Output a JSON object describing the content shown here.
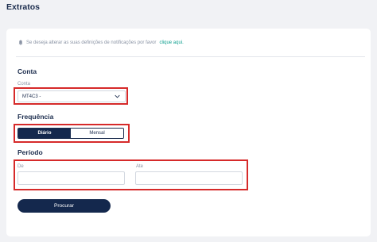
{
  "page": {
    "title": "Extratos"
  },
  "notice": {
    "text": "Se deseja alterar as suas definições de notificações por favor",
    "link": "clique aqui."
  },
  "conta": {
    "heading": "Conta",
    "label": "Conta",
    "value": "MT4C3 -"
  },
  "frequencia": {
    "heading": "Frequência",
    "options": [
      "Diário",
      "Mensal"
    ],
    "selected": "Diário"
  },
  "periodo": {
    "heading": "Período",
    "from_label": "De",
    "to_label": "Ate",
    "from_value": "",
    "to_value": ""
  },
  "search_button": "Procurar",
  "colors": {
    "primary": "#14284d",
    "link": "#0f9f8f",
    "highlight": "#d62a2a",
    "background": "#f1f2f5"
  }
}
